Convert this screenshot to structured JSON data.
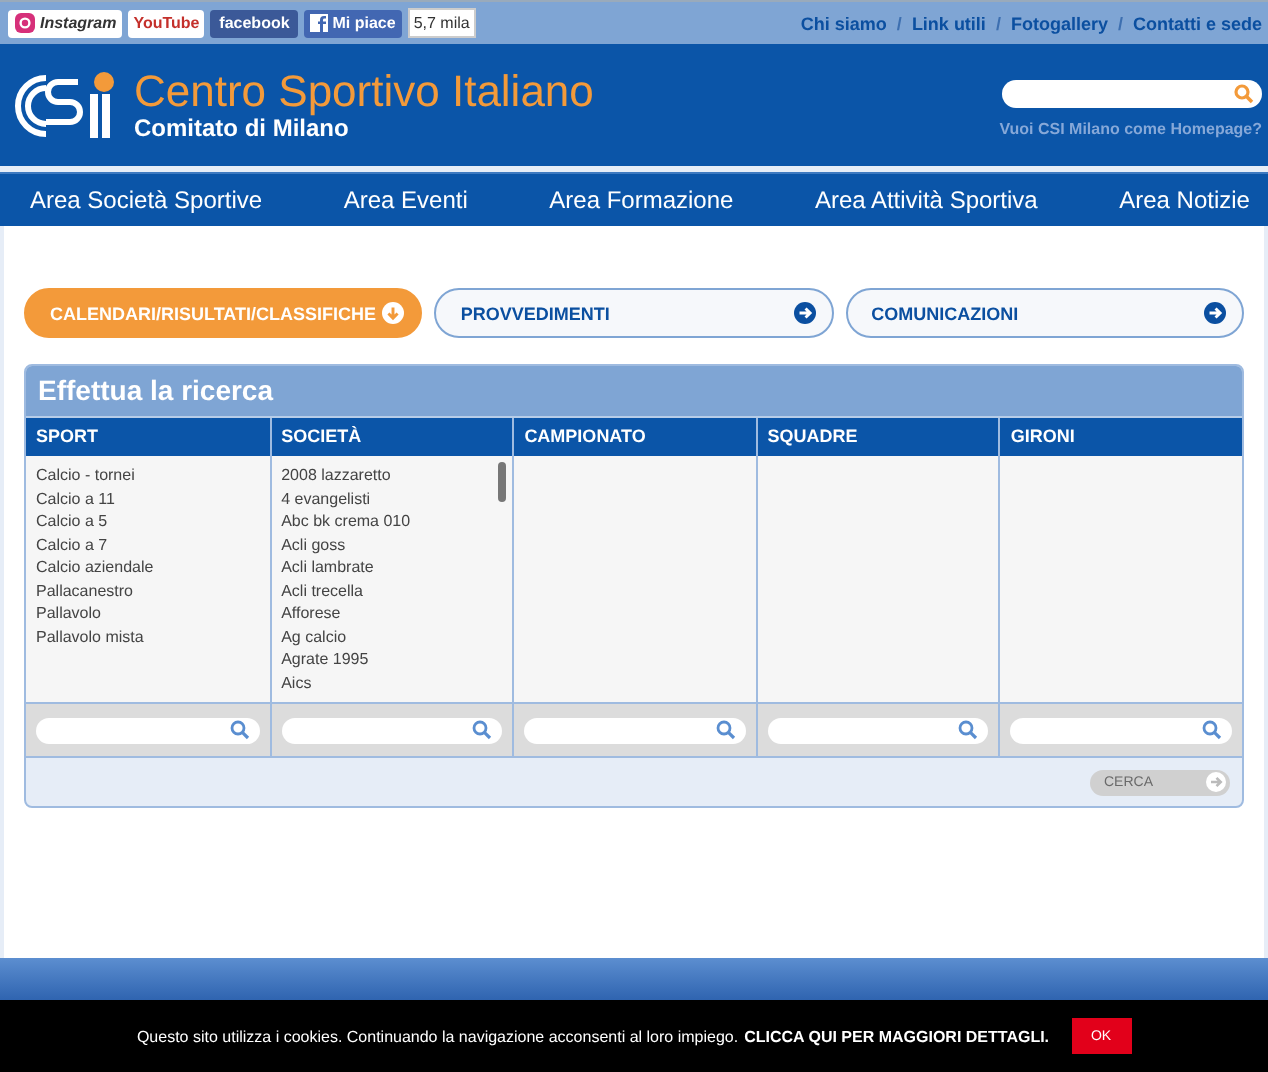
{
  "top_bar": {
    "social": [
      {
        "kind": "instagram",
        "label": "Instagram"
      },
      {
        "kind": "youtube",
        "label": "YouTube"
      },
      {
        "kind": "facebook",
        "label": "facebook"
      },
      {
        "kind": "like",
        "label": "Mi piace"
      }
    ],
    "like_count": "5,7 mila",
    "links": [
      "Chi siamo",
      "Link utili",
      "Fotogallery",
      "Contatti e sede"
    ],
    "separator": "/"
  },
  "header": {
    "title": "Centro Sportivo Italiano",
    "subtitle": "Comitato di Milano",
    "homepage_link": "Vuoi CSI Milano come Homepage?"
  },
  "nav": [
    "Area Società Sportive",
    "Area Eventi",
    "Area Formazione",
    "Area Attività Sportiva",
    "Area Notizie"
  ],
  "tabs": [
    {
      "label": "CALENDARI/RISULTATI/CLASSIFICHE",
      "selected": true
    },
    {
      "label": "PROVVEDIMENTI",
      "selected": false
    },
    {
      "label": "COMUNICAZIONI",
      "selected": false
    }
  ],
  "search_panel": {
    "title": "Effettua la ricerca",
    "columns": [
      {
        "heading": "SPORT",
        "items": [
          "Calcio - tornei",
          "Calcio a 11",
          "Calcio a 5",
          "Calcio a 7",
          "Calcio aziendale",
          "Pallacanestro",
          "Pallavolo",
          "Pallavolo mista"
        ]
      },
      {
        "heading": "SOCIETÀ",
        "items": [
          "2008 lazzaretto",
          "4 evangelisti",
          "Abc bk crema 010",
          "Acli goss",
          "Acli lambrate",
          "Acli trecella",
          "Afforese",
          "Ag calcio",
          "Agrate 1995",
          "Aics"
        ]
      },
      {
        "heading": "CAMPIONATO"
      },
      {
        "heading": "SQUADRE"
      },
      {
        "heading": "GIRONI"
      }
    ],
    "submit": {
      "label": "CERCA",
      "disabled": true
    }
  },
  "cookie_bar": {
    "text": "Questo sito utilizza i cookies. Continuando la navigazione acconsenti al loro impiego.",
    "link": "CLICCA QUI PER MAGGIORI DETTAGLI.",
    "button": "OK"
  }
}
